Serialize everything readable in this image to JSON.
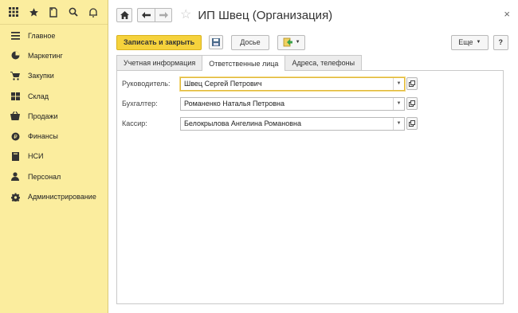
{
  "sidebar": {
    "items": [
      {
        "label": "Главное",
        "icon": "menu-lines-icon"
      },
      {
        "label": "Маркетинг",
        "icon": "marketing-icon"
      },
      {
        "label": "Закупки",
        "icon": "cart-icon"
      },
      {
        "label": "Склад",
        "icon": "warehouse-icon"
      },
      {
        "label": "Продажи",
        "icon": "sales-basket-icon"
      },
      {
        "label": "Финансы",
        "icon": "coins-icon"
      },
      {
        "label": "НСИ",
        "icon": "book-icon"
      },
      {
        "label": "Персонал",
        "icon": "person-icon"
      },
      {
        "label": "Администрирование",
        "icon": "gear-icon"
      }
    ]
  },
  "window": {
    "title": "ИП Швец (Организация)",
    "close_glyph": "×"
  },
  "toolbar": {
    "save_close_label": "Записать и закрыть",
    "dossier_label": "Досье",
    "more_label": "Еще",
    "help_label": "?"
  },
  "tabs": [
    {
      "label": "Учетная информация",
      "active": false
    },
    {
      "label": "Ответственные лица",
      "active": true
    },
    {
      "label": "Адреса, телефоны",
      "active": false
    }
  ],
  "fields": {
    "head": {
      "label": "Руководитель:",
      "value": "Швец Сергей Петрович"
    },
    "accountant": {
      "label": "Бухгалтер:",
      "value": "Романенко Наталья Петровна"
    },
    "cashier": {
      "label": "Кассир:",
      "value": "Белокрылова Ангелина Романовна"
    }
  },
  "colors": {
    "sidebar_bg": "#fbed9e",
    "primary_button": "#f5d23c",
    "focus_border": "#e1b93a"
  }
}
